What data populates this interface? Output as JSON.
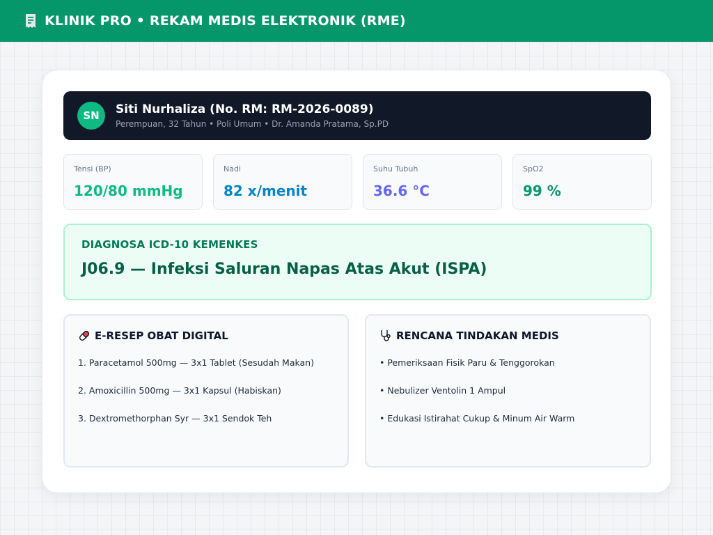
{
  "header": {
    "title": "KLINIK PRO • REKAM MEDIS ELEKTRONIK (RME)"
  },
  "patient": {
    "initials": "SN",
    "name_line": "Siti Nurhaliza (No. RM: RM-2026-0089)",
    "meta": "Perempuan, 32 Tahun • Poli Umum • Dr. Amanda Pratama, Sp.PD"
  },
  "vitals": [
    {
      "label": "Tensi (BP)",
      "value": "120/80 mmHg",
      "color": "#10b981"
    },
    {
      "label": "Nadi",
      "value": "82 x/menit",
      "color": "#0284c7"
    },
    {
      "label": "Suhu Tubuh",
      "value": "36.6 °C",
      "color": "#6366f1"
    },
    {
      "label": "SpO2",
      "value": "99 %",
      "color": "#059669"
    }
  ],
  "diagnosis": {
    "label": "DIAGNOSA ICD-10 KEMENKES",
    "value": "J06.9 — Infeksi Saluran Napas Atas Akut (ISPA)"
  },
  "prescription": {
    "title": "E-RESEP OBAT DIGITAL",
    "icon": "pill-icon",
    "items": [
      "1. Paracetamol 500mg — 3x1 Tablet (Sesudah Makan)",
      "2. Amoxicillin 500mg — 3x1 Kapsul (Habiskan)",
      "3. Dextromethorphan Syr — 3x1 Sendok Teh"
    ]
  },
  "plan": {
    "title": "RENCANA TINDAKAN MEDIS",
    "icon": "stethoscope-icon",
    "items": [
      "• Pemeriksaan Fisik Paru & Tenggorokan",
      "• Nebulizer Ventolin 1 Ampul",
      "• Edukasi Istirahat Cukup & Minum Air Warm"
    ]
  },
  "colors": {
    "brand": "#059669",
    "patient_bg": "#111827",
    "avatar": "#10b981"
  }
}
